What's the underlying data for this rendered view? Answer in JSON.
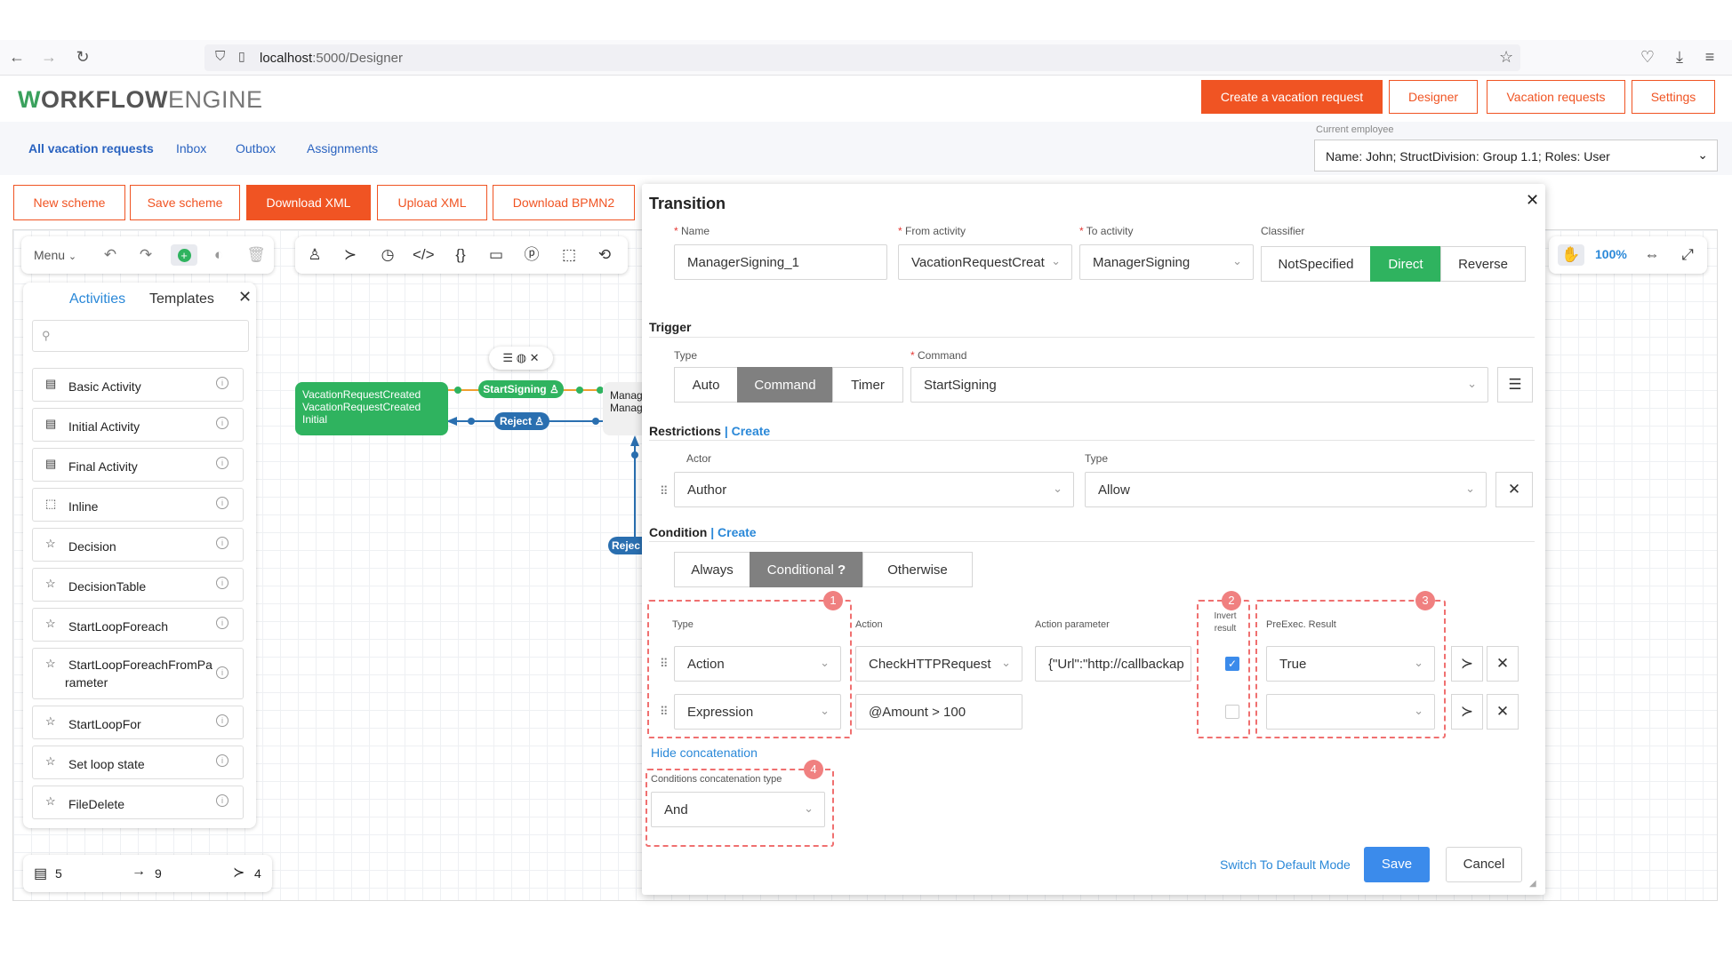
{
  "browser": {
    "url_host": "localhost",
    "url_path": ":5000/Designer"
  },
  "app": {
    "logo_w": "W",
    "logo_bold": "ORKFLOW",
    "logo_light": "ENGINE",
    "header_buttons": [
      "Create a vacation request",
      "Designer",
      "Vacation requests",
      "Settings"
    ]
  },
  "nav": {
    "links": [
      "All vacation requests",
      "Inbox",
      "Outbox",
      "Assignments"
    ],
    "employee_label": "Current employee",
    "employee_value": "Name: John; StructDivision: Group 1.1; Roles: User"
  },
  "scheme_buttons": [
    "New scheme",
    "Save scheme",
    "Download XML",
    "Upload XML",
    "Download BPMN2"
  ],
  "canvas": {
    "menu_label": "Menu",
    "zoom": "100%"
  },
  "sidebar": {
    "tabs": [
      "Activities",
      "Templates"
    ],
    "search_placeholder": "",
    "items": [
      "Basic Activity",
      "Initial Activity",
      "Final Activity",
      "Inline",
      "Decision",
      "DecisionTable",
      "StartLoopForeach",
      "StartLoopForeachFromPa",
      "rameter",
      "StartLoopFor",
      "Set loop state",
      "FileDelete"
    ]
  },
  "counters": {
    "activities": "5",
    "transitions": "9",
    "commands": "4"
  },
  "diagram": {
    "node1_l1": "VacationRequestCreated",
    "node1_l2": "VacationRequestCreated",
    "node1_l3": "Initial",
    "node2_l1": "Manag",
    "node2_l2": "Manag",
    "pill_start": "StartSigning",
    "pill_reject": "Reject",
    "pill_reject2": "Rejec"
  },
  "transition": {
    "title": "Transition",
    "name_label": "Name",
    "name_value": "ManagerSigning_1",
    "from_label": "From activity",
    "from_value": "VacationRequestCreat",
    "to_label": "To activity",
    "to_value": "ManagerSigning",
    "classifier_label": "Classifier",
    "classifier_options": [
      "NotSpecified",
      "Direct",
      "Reverse"
    ],
    "trigger_title": "Trigger",
    "trigger_type_label": "Type",
    "trigger_types": [
      "Auto",
      "Command",
      "Timer"
    ],
    "command_label": "Command",
    "command_value": "StartSigning",
    "restrictions_title": "Restrictions",
    "create_link": "Create",
    "actor_label": "Actor",
    "actor_value": "Author",
    "rtype_label": "Type",
    "rtype_value": "Allow",
    "condition_title": "Condition",
    "condition_options": [
      "Always",
      "Conditional",
      "Otherwise"
    ],
    "cond_q": "?",
    "col_type": "Type",
    "col_action": "Action",
    "col_param": "Action parameter",
    "col_invert_1": "Invert",
    "col_invert_2": "result",
    "col_preexec": "PreExec. Result",
    "row1": {
      "type": "Action",
      "action": "CheckHTTPRequest",
      "param": "{\"Url\":\"http://callbackap",
      "preexec": "True"
    },
    "row2": {
      "type": "Expression",
      "action": "@Amount > 100",
      "param": "",
      "preexec": ""
    },
    "hide_concat": "Hide concatenation",
    "concat_label": "Conditions concatenation type",
    "concat_value": "And",
    "switch_mode": "Switch To Default Mode",
    "save": "Save",
    "cancel": "Cancel",
    "badges": [
      "1",
      "2",
      "3",
      "4"
    ]
  }
}
